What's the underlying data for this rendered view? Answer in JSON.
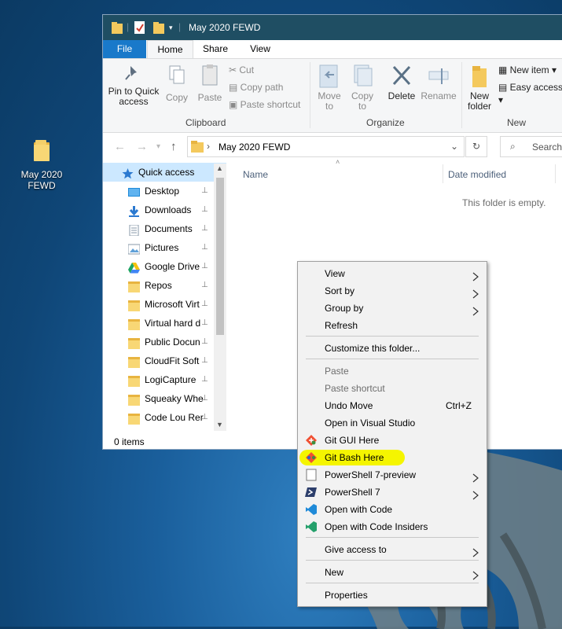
{
  "desktop": {
    "icon_label": "May 2020 FEWD"
  },
  "window": {
    "title": "May 2020 FEWD",
    "tabs": {
      "file": "File",
      "home": "Home",
      "share": "Share",
      "view": "View"
    },
    "ribbon": {
      "pin_quick_access": "Pin to Quick access",
      "copy": "Copy",
      "paste": "Paste",
      "cut": "Cut",
      "copy_path": "Copy path",
      "paste_shortcut": "Paste shortcut",
      "clipboard_group": "Clipboard",
      "move_to": "Move to",
      "copy_to": "Copy to",
      "delete": "Delete",
      "rename": "Rename",
      "organize_group": "Organize",
      "new_folder": "New folder",
      "new_item": "New item",
      "easy_access": "Easy access",
      "new_group": "New"
    },
    "address": {
      "path": "May 2020 FEWD",
      "search_placeholder": "Search"
    },
    "nav_items": [
      {
        "label": "Quick access",
        "icon": "star-icon",
        "pinned": false
      },
      {
        "label": "Desktop",
        "icon": "desktop-icon",
        "pinned": true
      },
      {
        "label": "Downloads",
        "icon": "download-arrow-icon",
        "pinned": true
      },
      {
        "label": "Documents",
        "icon": "documents-icon",
        "pinned": true
      },
      {
        "label": "Pictures",
        "icon": "pictures-icon",
        "pinned": true
      },
      {
        "label": "Google Drive",
        "icon": "google-drive-icon",
        "pinned": true
      },
      {
        "label": "Repos",
        "icon": "folder-icon",
        "pinned": true
      },
      {
        "label": "Microsoft Virt",
        "icon": "folder-icon",
        "pinned": true
      },
      {
        "label": "Virtual hard d",
        "icon": "folder-icon",
        "pinned": true
      },
      {
        "label": "Public Docun",
        "icon": "folder-icon",
        "pinned": true
      },
      {
        "label": "CloudFit Soft",
        "icon": "folder-icon",
        "pinned": true
      },
      {
        "label": "LogiCapture",
        "icon": "folder-icon",
        "pinned": true
      },
      {
        "label": "Squeaky Whe",
        "icon": "folder-icon",
        "pinned": true
      },
      {
        "label": "Code Lou Rer",
        "icon": "folder-icon",
        "pinned": true
      }
    ],
    "columns": {
      "name": "Name",
      "date_modified": "Date modified"
    },
    "empty_message": "This folder is empty.",
    "status": "0 items"
  },
  "context_menu": {
    "items": [
      {
        "label": "View",
        "submenu": true
      },
      {
        "label": "Sort by",
        "submenu": true
      },
      {
        "label": "Group by",
        "submenu": true
      },
      {
        "label": "Refresh"
      },
      {
        "label": "Customize this folder..."
      },
      {
        "label": "Paste",
        "disabled": true
      },
      {
        "label": "Paste shortcut",
        "disabled": true
      },
      {
        "label": "Undo Move",
        "shortcut": "Ctrl+Z"
      },
      {
        "label": "Open in Visual Studio"
      },
      {
        "label": "Git GUI Here",
        "icon": "git-gui-icon"
      },
      {
        "label": "Git Bash Here",
        "icon": "git-bash-icon",
        "highlighted": true
      },
      {
        "label": "PowerShell 7-preview",
        "icon": "powershell-preview-icon",
        "submenu": true
      },
      {
        "label": "PowerShell 7",
        "icon": "powershell-icon",
        "submenu": true
      },
      {
        "label": "Open with Code",
        "icon": "vscode-icon"
      },
      {
        "label": "Open with Code Insiders",
        "icon": "vscode-insiders-icon"
      },
      {
        "label": "Give access to",
        "submenu": true
      },
      {
        "label": "New",
        "submenu": true
      },
      {
        "label": "Properties"
      }
    ]
  },
  "colors": {
    "titlebar": "#1f4e63",
    "file_tab": "#1979ca",
    "highlight": "#f5f500",
    "selected_nav": "#cce8ff"
  }
}
